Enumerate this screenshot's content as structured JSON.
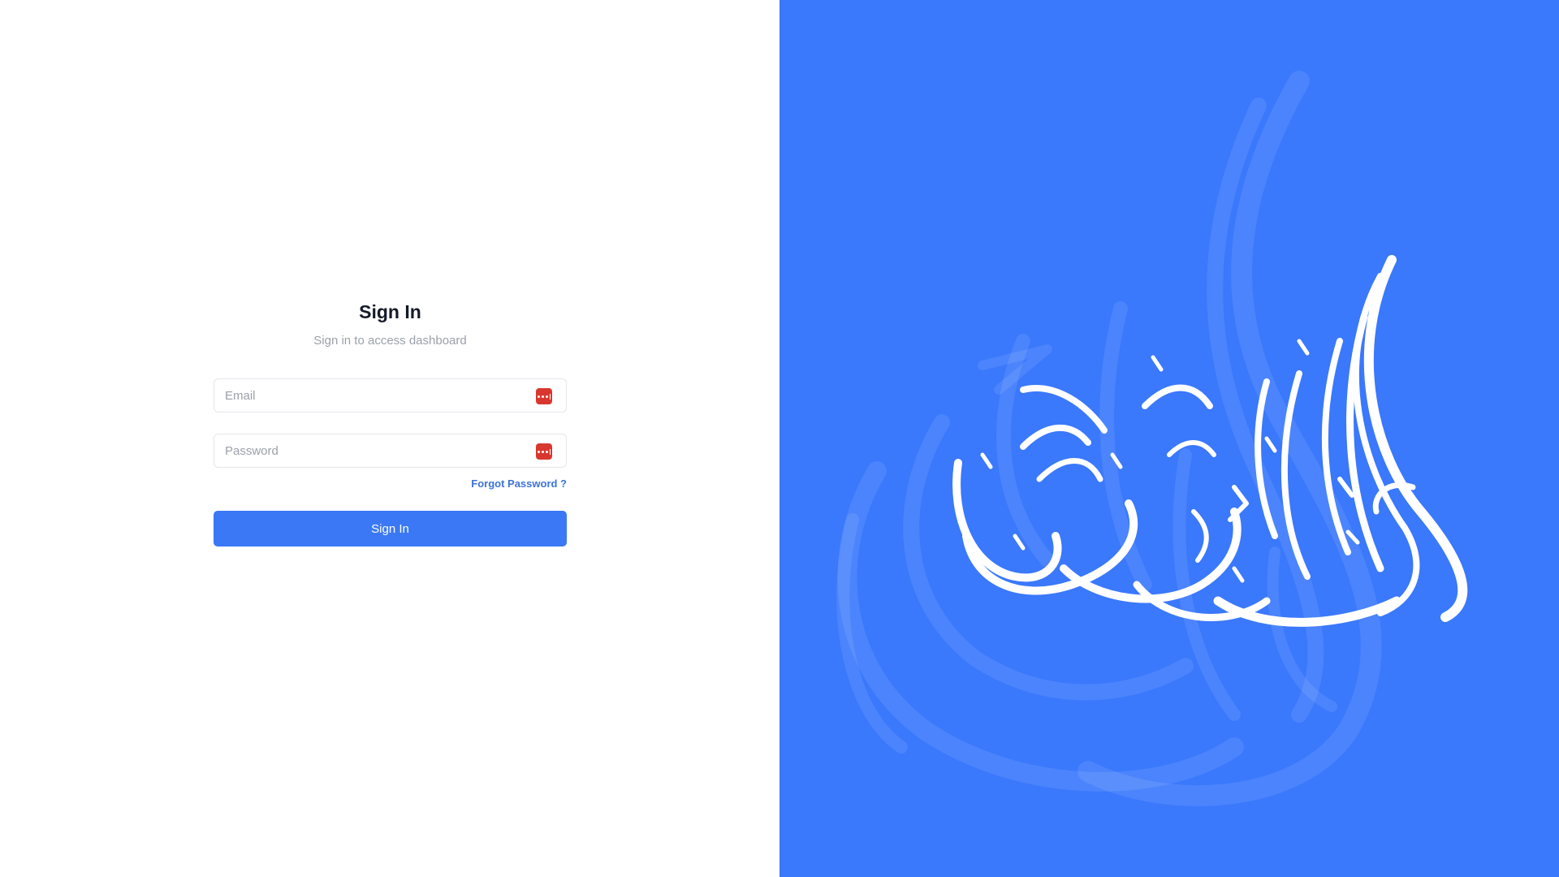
{
  "login": {
    "title": "Sign In",
    "subtitle": "Sign in to access dashboard",
    "email": {
      "placeholder": "Email",
      "value": "",
      "icon": "password-manager-icon"
    },
    "password": {
      "placeholder": "Password",
      "value": "",
      "icon": "password-manager-icon"
    },
    "forgot_label": "Forgot Password ?",
    "submit_label": "Sign In"
  },
  "brand": {
    "panel_color": "#3a78fc",
    "accent": "#3a78f5",
    "icon_color": "#d8372f",
    "art": "arabic-calligraphy-logo"
  }
}
